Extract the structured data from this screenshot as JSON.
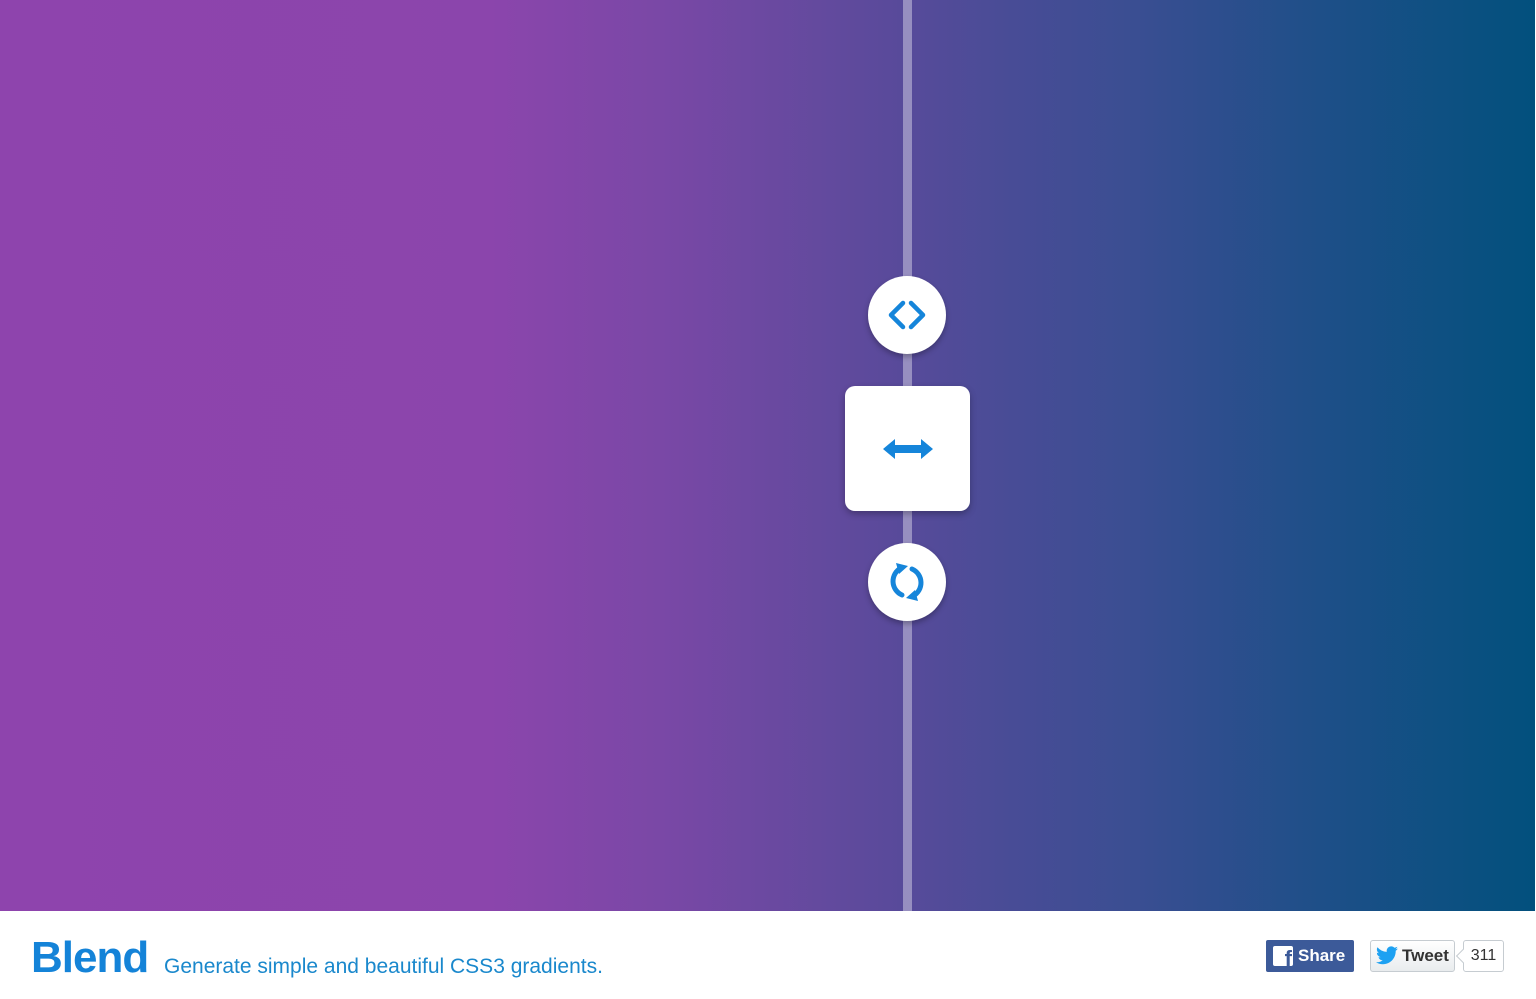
{
  "colors": {
    "gradient_start": "#8e44ad",
    "gradient_end": "#02507d",
    "accent": "#1483d8",
    "facebook": "#3c5a99"
  },
  "controls": {
    "code_icon": "code-icon",
    "swap_icon": "swap-direction-icon",
    "refresh_icon": "refresh-icon"
  },
  "footer": {
    "brand": "Blend",
    "tagline": "Generate simple and beautiful CSS3 gradients.",
    "facebook_share": {
      "icon": "facebook-icon",
      "label": "Share"
    },
    "tweet": {
      "icon": "twitter-bird-icon",
      "label": "Tweet",
      "count": "311"
    }
  }
}
